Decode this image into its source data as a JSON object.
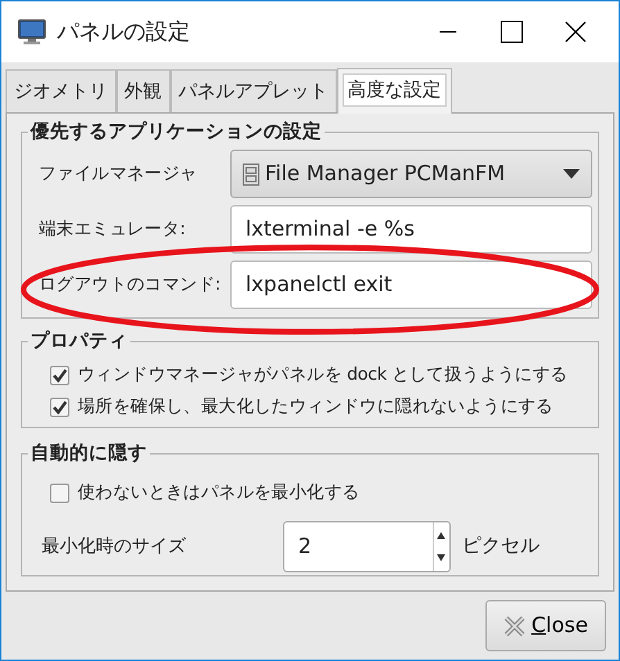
{
  "window": {
    "title": "パネルの設定"
  },
  "tabs": [
    {
      "label": "ジオメトリ",
      "selected": false
    },
    {
      "label": "外観",
      "selected": false
    },
    {
      "label": "パネルアプレット",
      "selected": false
    },
    {
      "label": "高度な設定",
      "selected": true
    }
  ],
  "preferred_apps": {
    "title": "優先するアプリケーションの設定",
    "rows": [
      {
        "kind": "dropdown",
        "label": "ファイルマネージャ",
        "value": "File Manager PCManFM",
        "highlighted": false
      },
      {
        "kind": "text",
        "label": "端末エミュレータ:",
        "value": "lxterminal -e %s",
        "highlighted": false
      },
      {
        "kind": "text",
        "label": "ログアウトのコマンド:",
        "value": "lxpanelctl exit",
        "highlighted": true
      }
    ]
  },
  "properties": {
    "title": "プロパティ",
    "checkboxes": [
      {
        "label": "ウィンドウマネージャがパネルを dock として扱うようにする",
        "checked": true
      },
      {
        "label": "場所を確保し、最大化したウィンドウに隠れないようにする",
        "checked": true
      }
    ]
  },
  "autohide": {
    "title": "自動的に隠す",
    "checkboxes": [
      {
        "label": "使わないときはパネルを最小化する",
        "checked": false
      }
    ],
    "size": {
      "label": "最小化時のサイズ",
      "value": "2",
      "unit": "ピクセル"
    }
  },
  "buttons": [
    {
      "label": "Close"
    }
  ]
}
